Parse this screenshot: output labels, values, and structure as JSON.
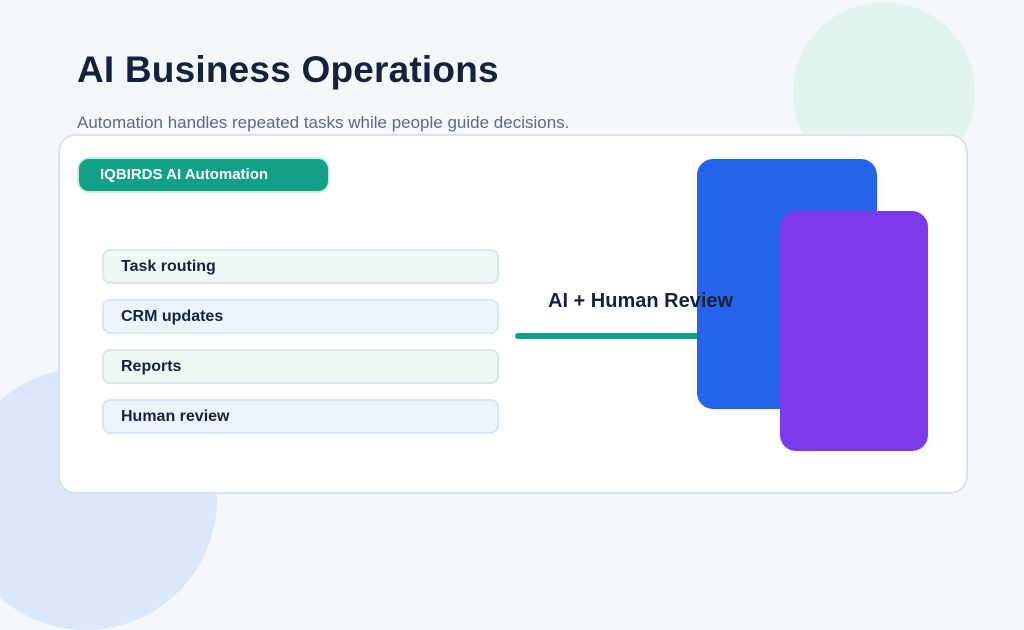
{
  "header": {
    "title": "AI Business Operations",
    "subtitle": "Automation handles repeated tasks while people guide decisions."
  },
  "panel": {
    "badge_label": "IQBIRDS AI Automation",
    "tasks": [
      {
        "label": "Task routing"
      },
      {
        "label": "CRM updates"
      },
      {
        "label": "Reports"
      },
      {
        "label": "Human review"
      }
    ],
    "review_label": "AI + Human Review"
  },
  "colors": {
    "accent_green": "#12a086",
    "block_blue": "#2563eb",
    "block_purple": "#7c3aed",
    "text_dark": "#15223b",
    "background": "#f4f7fb"
  }
}
